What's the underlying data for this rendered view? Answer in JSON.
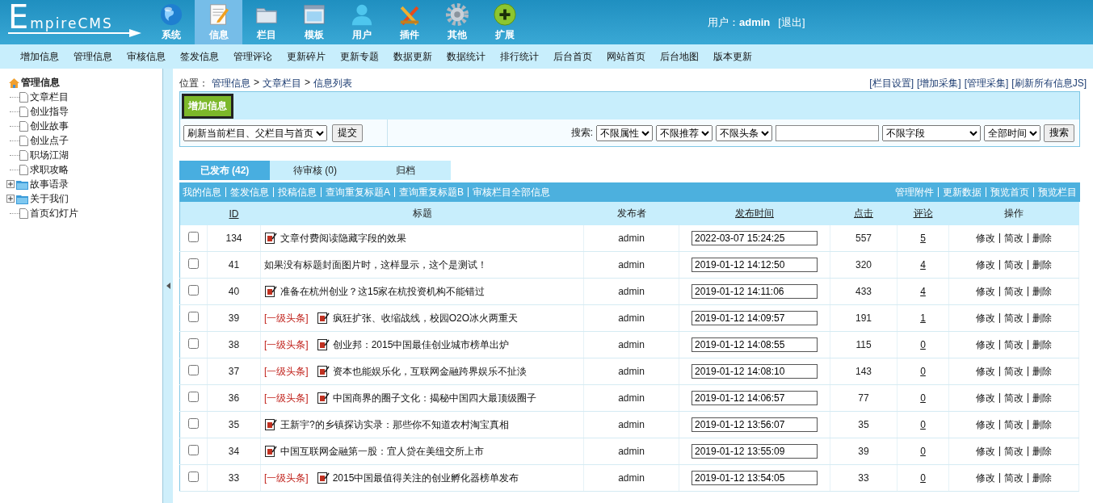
{
  "header": {
    "logo": "EmpireCMS",
    "nav": [
      {
        "kind": "globe",
        "label": "系统",
        "selected": false
      },
      {
        "kind": "notepad",
        "label": "信息",
        "selected": true
      },
      {
        "kind": "folder",
        "label": "栏目",
        "selected": false
      },
      {
        "kind": "window",
        "label": "模板",
        "selected": false
      },
      {
        "kind": "person",
        "label": "用户",
        "selected": false
      },
      {
        "kind": "tools",
        "label": "插件",
        "selected": false
      },
      {
        "kind": "gear",
        "label": "其他",
        "selected": false
      },
      {
        "kind": "plus",
        "label": "扩展",
        "selected": false
      }
    ],
    "user_label": "用户：",
    "user_name": "admin",
    "logout": "[退出]"
  },
  "submenu": [
    "增加信息",
    "管理信息",
    "审核信息",
    "签发信息",
    "管理评论",
    "更新碎片",
    "更新专题",
    "数据更新",
    "数据统计",
    "排行统计",
    "后台首页",
    "网站首页",
    "后台地图",
    "版本更新"
  ],
  "sidebar": {
    "root": "管理信息",
    "children": [
      {
        "kind": "page",
        "label": "文章栏目"
      },
      {
        "kind": "page",
        "label": "创业指导"
      },
      {
        "kind": "page",
        "label": "创业故事"
      },
      {
        "kind": "page",
        "label": "创业点子"
      },
      {
        "kind": "page",
        "label": "职场江湖"
      },
      {
        "kind": "page",
        "label": "求职攻略"
      },
      {
        "kind": "folder",
        "label": "故事语录",
        "expanded": false
      },
      {
        "kind": "folder",
        "label": "关于我们",
        "expanded": false
      },
      {
        "kind": "page",
        "label": "首页幻灯片"
      }
    ]
  },
  "breadcrumb": {
    "label": "位置：",
    "separator": ">",
    "items": [
      "管理信息",
      "文章栏目",
      "信息列表"
    ]
  },
  "top_links": [
    "[栏目设置]",
    "[增加采集]",
    "[管理采集]",
    "[刷新所有信息JS]"
  ],
  "toolbar": {
    "add_button": "增加信息",
    "refresh_select": "刷新当前栏目、父栏目与首页",
    "submit_button": "提交",
    "search_label": "搜索:",
    "filters": [
      "不限属性",
      "不限推荐",
      "不限头条"
    ],
    "field_select": "不限字段",
    "time_select": "全部时间",
    "search_button": "搜索"
  },
  "tabs": [
    {
      "label": "已发布 (42)",
      "selected": true
    },
    {
      "label": "待审核 (0)",
      "selected": false
    },
    {
      "label": "归档",
      "selected": false
    }
  ],
  "list_links_left": [
    "我的信息",
    "签发信息",
    "投稿信息",
    "查询重复标题A",
    "查询重复标题B",
    "审核栏目全部信息"
  ],
  "list_links_right": [
    "管理附件",
    "更新数据",
    "预览首页",
    "预览栏目"
  ],
  "table": {
    "columns": [
      "ID",
      "标题",
      "发布者",
      "发布时间",
      "点击",
      "评论",
      "操作"
    ],
    "rows": [
      {
        "checked": false,
        "id": "134",
        "icon": true,
        "title": "文章付费阅读隐藏字段的效果",
        "publisher": "admin",
        "time": "2022-03-07 15:24:25",
        "clicks": "557",
        "comments": "5",
        "actions": [
          "修改",
          "简改",
          "删除"
        ]
      },
      {
        "checked": false,
        "id": "41",
        "icon": false,
        "title": "如果没有标题封面图片时，这样显示，这个是测试！",
        "publisher": "admin",
        "time": "2019-01-12 14:12:50",
        "clicks": "320",
        "comments": "4",
        "actions": [
          "修改",
          "简改",
          "删除"
        ]
      },
      {
        "checked": false,
        "id": "40",
        "icon": true,
        "title": "准备在杭州创业？这15家在杭投资机构不能错过",
        "publisher": "admin",
        "time": "2019-01-12 14:11:06",
        "clicks": "433",
        "comments": "4",
        "actions": [
          "修改",
          "简改",
          "删除"
        ]
      },
      {
        "checked": false,
        "id": "39",
        "tag": "[一级头条]",
        "icon": true,
        "title": "疯狂扩张、收缩战线，校园O2O冰火两重天",
        "publisher": "admin",
        "time": "2019-01-12 14:09:57",
        "clicks": "191",
        "comments": "1",
        "actions": [
          "修改",
          "简改",
          "删除"
        ]
      },
      {
        "checked": false,
        "id": "38",
        "tag": "[一级头条]",
        "icon": true,
        "title": "创业邦：2015中国最佳创业城市榜单出炉",
        "publisher": "admin",
        "time": "2019-01-12 14:08:55",
        "clicks": "115",
        "comments": "0",
        "actions": [
          "修改",
          "简改",
          "删除"
        ]
      },
      {
        "checked": false,
        "id": "37",
        "tag": "[一级头条]",
        "icon": true,
        "title": "资本也能娱乐化，互联网金融跨界娱乐不扯淡",
        "publisher": "admin",
        "time": "2019-01-12 14:08:10",
        "clicks": "143",
        "comments": "0",
        "actions": [
          "修改",
          "简改",
          "删除"
        ]
      },
      {
        "checked": false,
        "id": "36",
        "tag": "[一级头条]",
        "icon": true,
        "title": "中国商界的圈子文化：揭秘中国四大最顶级圈子",
        "publisher": "admin",
        "time": "2019-01-12 14:06:57",
        "clicks": "77",
        "comments": "0",
        "actions": [
          "修改",
          "简改",
          "删除"
        ]
      },
      {
        "checked": false,
        "id": "35",
        "icon": true,
        "title": "王新宇?的乡镇探访实录：那些你不知道农村淘宝真相",
        "publisher": "admin",
        "time": "2019-01-12 13:56:07",
        "clicks": "35",
        "comments": "0",
        "actions": [
          "修改",
          "简改",
          "删除"
        ]
      },
      {
        "checked": false,
        "id": "34",
        "icon": true,
        "title": "中国互联网金融第一股：宜人贷在美纽交所上市",
        "publisher": "admin",
        "time": "2019-01-12 13:55:09",
        "clicks": "39",
        "comments": "0",
        "actions": [
          "修改",
          "简改",
          "删除"
        ]
      },
      {
        "checked": false,
        "id": "33",
        "tag": "[一级头条]",
        "icon": true,
        "title": "2015中国最值得关注的创业孵化器榜单发布",
        "publisher": "admin",
        "time": "2019-01-12 13:54:05",
        "clicks": "33",
        "comments": "0",
        "actions": [
          "修改",
          "简改",
          "删除"
        ]
      }
    ]
  }
}
